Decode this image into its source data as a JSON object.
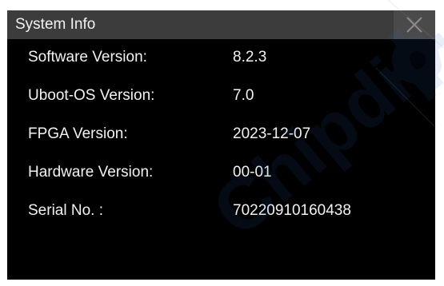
{
  "dialog": {
    "title": "System Info",
    "close_icon": "close-icon"
  },
  "info": {
    "rows": [
      {
        "label": "Software Version:",
        "value": "8.2.3"
      },
      {
        "label": "Uboot-OS Version:",
        "value": "7.0"
      },
      {
        "label": "FPGA Version:",
        "value": "2023-12-07"
      },
      {
        "label": "Hardware Version:",
        "value": "00-01"
      },
      {
        "label": "Serial No. :",
        "value": "70220910160438"
      }
    ]
  },
  "colors": {
    "background": "#000000",
    "titlebar": "#3c3c3c",
    "text": "#f2f2f2",
    "watermark": "#2e6fc7"
  },
  "watermark": {
    "text": "Chipdip",
    "icon": "gear-icon"
  }
}
